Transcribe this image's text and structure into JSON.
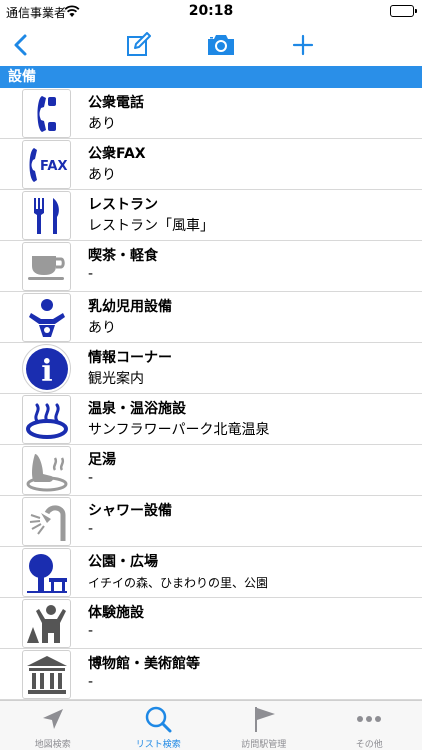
{
  "status": {
    "carrier": "通信事業者",
    "time": "20:18"
  },
  "section": {
    "title": "設備"
  },
  "items": [
    {
      "title": "公衆電話",
      "value": "あり",
      "icon": "telephone-icon"
    },
    {
      "title": "公衆FAX",
      "value": "あり",
      "icon": "fax-icon",
      "icon_text": "FAX"
    },
    {
      "title": "レストラン",
      "value": "レストラン「風車」",
      "icon": "restaurant-icon"
    },
    {
      "title": "喫茶・軽食",
      "value": "-",
      "icon": "coffee-cup-icon"
    },
    {
      "title": "乳幼児用設備",
      "value": "あり",
      "icon": "baby-care-icon"
    },
    {
      "title": "情報コーナー",
      "value": "観光案内",
      "icon": "information-icon",
      "icon_text": "i"
    },
    {
      "title": "温泉・温浴施設",
      "value": "サンフラワーパーク北竜温泉",
      "icon": "hot-spring-icon"
    },
    {
      "title": "足湯",
      "value": "-",
      "icon": "foot-bath-icon"
    },
    {
      "title": "シャワー設備",
      "value": "-",
      "icon": "shower-icon"
    },
    {
      "title": "公園・広場",
      "value": "イチイの森、ひまわりの里、公園",
      "icon": "park-icon"
    },
    {
      "title": "体験施設",
      "value": "-",
      "icon": "experience-icon"
    },
    {
      "title": "博物館・美術館等",
      "value": "-",
      "icon": "museum-icon"
    }
  ],
  "tabs": [
    {
      "label": "地図検索",
      "icon": "map-arrow-icon"
    },
    {
      "label": "リスト検索",
      "icon": "magnifier-icon"
    },
    {
      "label": "訪問駅管理",
      "icon": "flag-icon"
    },
    {
      "label": "その他",
      "icon": "more-dots-icon"
    }
  ],
  "colors": {
    "accent": "#1e88e5",
    "section_header": "#2a8fe8",
    "icon_blue": "#1a2db0",
    "icon_gray": "#9a9a9a"
  }
}
